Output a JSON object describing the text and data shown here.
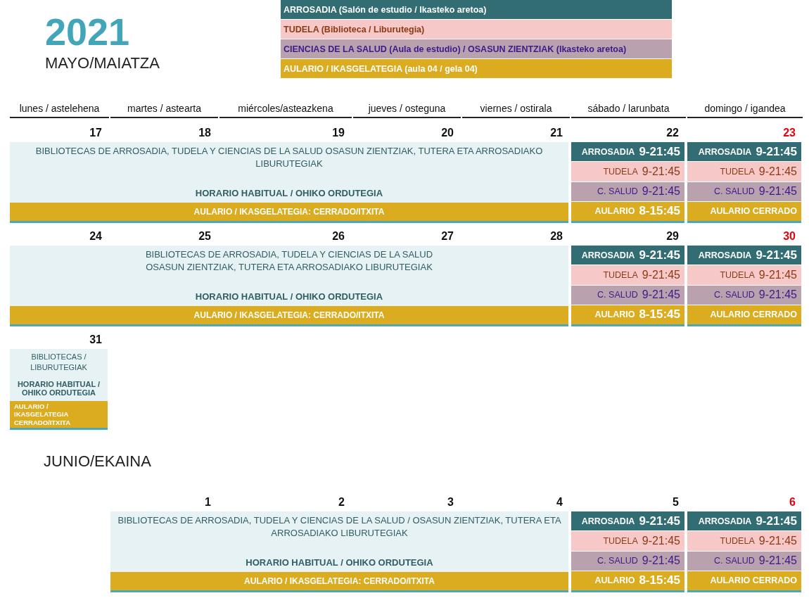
{
  "year": "2021",
  "legend": [
    {
      "kind": "arrosadia",
      "label": "ARROSADIA (Salón de estudio / Ikasteko aretoa)"
    },
    {
      "kind": "tudela",
      "label": "TUDELA (Biblioteca / Liburutegia)"
    },
    {
      "kind": "salud",
      "label": "CIENCIAS DE LA SALUD (Aula de estudio) / OSASUN ZIENTZIAK (Ikasteko aretoa)"
    },
    {
      "kind": "aulario",
      "label": "AULARIO / IKASGELATEGIA (aula 04 / gela 04)"
    }
  ],
  "weekdays": [
    "lunes / astelehena",
    "martes / astearta",
    "miércoles/asteazkena",
    "jueves / osteguna",
    "viernes / ostirala",
    "sábado / larunbata",
    "domingo / igandea"
  ],
  "months": [
    {
      "title": "MAYO/MAIATZA",
      "weeks": [
        {
          "days": [
            {
              "kind": "day",
              "number": "17",
              "holiday": false
            },
            {
              "kind": "day",
              "number": "18",
              "holiday": false
            },
            {
              "kind": "day",
              "number": "19",
              "holiday": false
            },
            {
              "kind": "day",
              "number": "20",
              "holiday": false
            },
            {
              "kind": "day",
              "number": "21",
              "holiday": false
            },
            {
              "kind": "day",
              "number": "22",
              "holiday": false
            },
            {
              "kind": "day",
              "number": "23",
              "holiday": true
            }
          ],
          "weekday_block": {
            "libraries": [
              "BIBLIOTECAS DE ARROSADIA, TUDELA Y CIENCIAS DE LA SALUD OSASUN ZIENTZIAK, TUTERA ETA ARROSADIAKO LIBURUTEGIAK"
            ],
            "hours": "HORARIO HABITUAL / OHIKO ORDUTEGIA",
            "aulario": "AULARIO / IKASGELATEGIA: CERRADO/ITXITA"
          },
          "weekend": [
            {
              "rows": [
                {
                  "kind": "arrosadia",
                  "label": "ARROSADIA",
                  "hours": "9-21:45"
                },
                {
                  "kind": "tudela",
                  "label": "TUDELA",
                  "hours": "9-21:45"
                },
                {
                  "kind": "salud",
                  "label": "C. SALUD",
                  "hours": "9-21:45"
                },
                {
                  "kind": "aulario",
                  "label": "AULARIO",
                  "hours": "8-15:45"
                }
              ]
            },
            {
              "rows": [
                {
                  "kind": "arrosadia",
                  "label": "ARROSADIA",
                  "hours": "9-21:45"
                },
                {
                  "kind": "tudela",
                  "label": "TUDELA",
                  "hours": "9-21:45"
                },
                {
                  "kind": "salud",
                  "label": "C. SALUD",
                  "hours": "9-21:45"
                },
                {
                  "kind": "aulario",
                  "label": "AULARIO CERRADO"
                }
              ]
            }
          ]
        },
        {
          "days": [
            {
              "kind": "day",
              "number": "24",
              "holiday": false
            },
            {
              "kind": "day",
              "number": "25",
              "holiday": false
            },
            {
              "kind": "day",
              "number": "26",
              "holiday": false
            },
            {
              "kind": "day",
              "number": "27",
              "holiday": false
            },
            {
              "kind": "day",
              "number": "28",
              "holiday": false
            },
            {
              "kind": "day",
              "number": "29",
              "holiday": false
            },
            {
              "kind": "day",
              "number": "30",
              "holiday": true
            }
          ],
          "weekday_block": {
            "libraries": [
              "BIBLIOTECAS DE ARROSADIA, TUDELA Y CIENCIAS DE LA SALUD",
              "OSASUN ZIENTZIAK, TUTERA ETA ARROSADIAKO LIBURUTEGIAK"
            ],
            "hours": "HORARIO HABITUAL / OHIKO ORDUTEGIA",
            "aulario": "AULARIO / IKASGELATEGIA: CERRADO/ITXITA"
          },
          "weekend": [
            {
              "rows": [
                {
                  "kind": "arrosadia",
                  "label": "ARROSADIA",
                  "hours": "9-21:45"
                },
                {
                  "kind": "tudela",
                  "label": "TUDELA",
                  "hours": "9-21:45"
                },
                {
                  "kind": "salud",
                  "label": "C. SALUD",
                  "hours": "9-21:45"
                },
                {
                  "kind": "aulario",
                  "label": "AULARIO",
                  "hours": "8-15:45"
                }
              ]
            },
            {
              "rows": [
                {
                  "kind": "arrosadia",
                  "label": "ARROSADIA",
                  "hours": "9-21:45"
                },
                {
                  "kind": "tudela",
                  "label": "TUDELA",
                  "hours": "9-21:45"
                },
                {
                  "kind": "salud",
                  "label": "C. SALUD",
                  "hours": "9-21:45"
                },
                {
                  "kind": "aulario",
                  "label": "AULARIO CERRADO"
                }
              ]
            }
          ]
        },
        {
          "days": [
            {
              "kind": "day",
              "number": "31",
              "holiday": false
            }
          ],
          "weekday_block": {
            "libraries": [
              "BIBLIOTECAS / LIBURUTEGIAK"
            ],
            "hours": "HORARIO HABITUAL / OHIKO ORDUTEGIA",
            "aulario": "AULARIO / IKASGELATEGIA CERRADO/ITXITA"
          }
        }
      ]
    },
    {
      "title": "JUNIO/EKAINA",
      "weeks": [
        {
          "days": [
            {
              "kind": "empty"
            },
            {
              "kind": "day",
              "number": "1",
              "holiday": false
            },
            {
              "kind": "day",
              "number": "2",
              "holiday": false
            },
            {
              "kind": "day",
              "number": "3",
              "holiday": false
            },
            {
              "kind": "day",
              "number": "4",
              "holiday": false
            },
            {
              "kind": "day",
              "number": "5",
              "holiday": false
            },
            {
              "kind": "day",
              "number": "6",
              "holiday": true
            }
          ],
          "weekday_block": {
            "libraries": [
              "BIBLIOTECAS DE ARROSADIA, TUDELA Y CIENCIAS DE LA SALUD / OSASUN ZIENTZIAK, TUTERA ETA ARROSADIAKO LIBURUTEGIAK"
            ],
            "hours": "HORARIO HABITUAL / OHIKO ORDUTEGIA",
            "aulario": "AULARIO / IKASGELATEGIA: CERRADO/ITXITA"
          },
          "weekend": [
            {
              "rows": [
                {
                  "kind": "arrosadia",
                  "label": "ARROSADIA",
                  "hours": "9-21:45"
                },
                {
                  "kind": "tudela",
                  "label": "TUDELA",
                  "hours": "9-21:45"
                },
                {
                  "kind": "salud",
                  "label": "C. SALUD",
                  "hours": "9-21:45"
                },
                {
                  "kind": "aulario",
                  "label": "AULARIO",
                  "hours": "8-15:45"
                }
              ]
            },
            {
              "rows": [
                {
                  "kind": "arrosadia",
                  "label": "ARROSADIA",
                  "hours": "9-21:45"
                },
                {
                  "kind": "tudela",
                  "label": "TUDELA",
                  "hours": "9-21:45"
                },
                {
                  "kind": "salud",
                  "label": "C. SALUD",
                  "hours": "9-21:45"
                },
                {
                  "kind": "aulario",
                  "label": "AULARIO CERRADO"
                }
              ]
            }
          ]
        }
      ]
    }
  ]
}
